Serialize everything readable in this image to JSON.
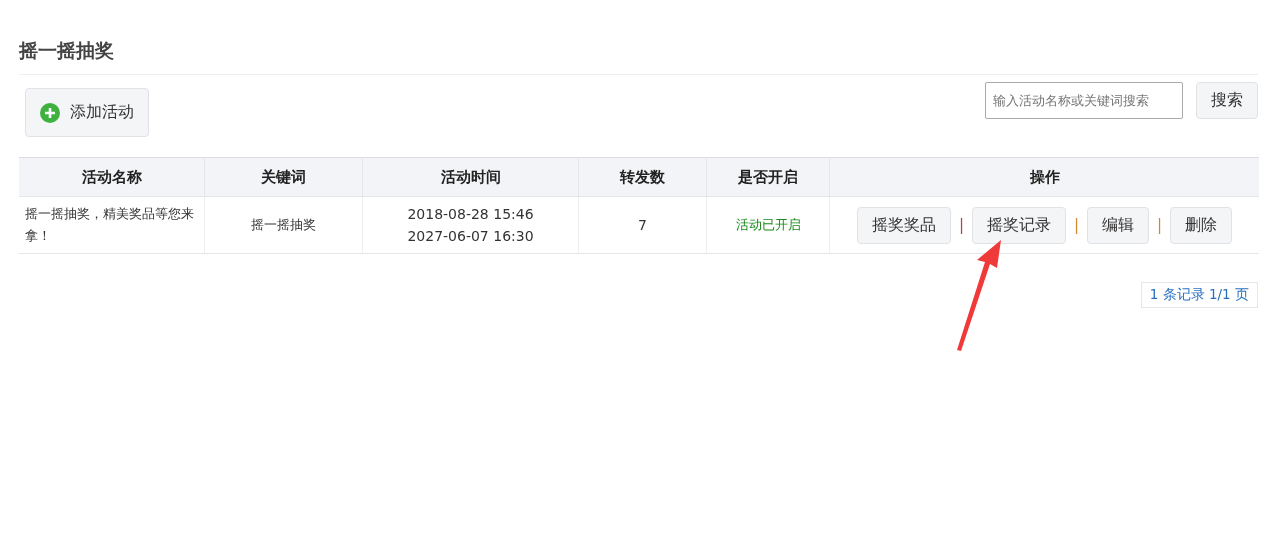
{
  "page_title": "摇一摇抽奖",
  "add_button": {
    "label": "添加活动"
  },
  "search": {
    "placeholder": "输入活动名称或关键词搜索",
    "button": "搜索"
  },
  "table": {
    "columns": [
      "活动名称",
      "关键词",
      "活动时间",
      "转发数",
      "是否开启",
      "操作"
    ],
    "rows": [
      {
        "name": "摇一摇抽奖，精美奖品等您来拿！",
        "keyword": "摇一摇抽奖",
        "start": "2018-08-28 15:46",
        "end": "2027-06-07 16:30",
        "shares": "7",
        "status": "活动已开启",
        "enabled": true,
        "actions": [
          {
            "label": "摇奖奖品"
          },
          {
            "separator": "|",
            "label": "摇奖记录"
          },
          {
            "separator": "|",
            "label": "编辑"
          },
          {
            "separator": "|",
            "label": "删除"
          }
        ]
      }
    ]
  },
  "pagination": "1 条记录 1/1 页"
}
